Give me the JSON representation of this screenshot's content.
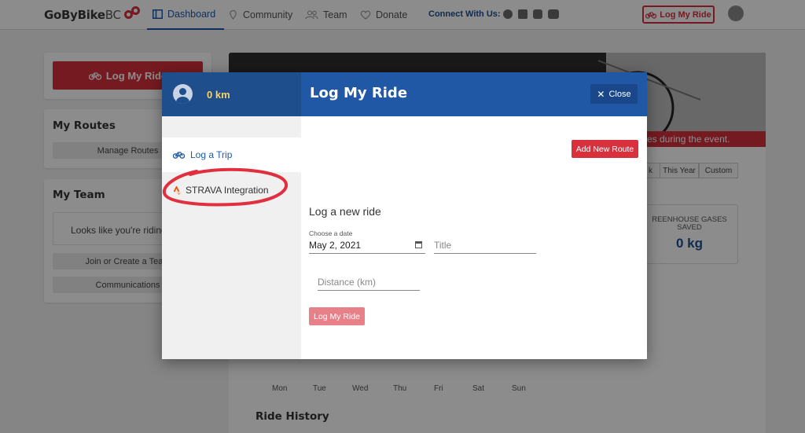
{
  "brand": {
    "name": "GoByBike",
    "suffix": "BC"
  },
  "nav": {
    "items": [
      {
        "label": "Dashboard",
        "icon": "dashboard-icon",
        "active": true
      },
      {
        "label": "Community",
        "icon": "map-pin-icon"
      },
      {
        "label": "Team",
        "icon": "team-icon"
      },
      {
        "label": "Donate",
        "icon": "heart-icon"
      }
    ],
    "connect_label": "Connect With Us:",
    "social": [
      "facebook-icon",
      "twitter-icon",
      "instagram-icon",
      "youtube-icon"
    ],
    "log_ride_label": "Log My Ride"
  },
  "sidebar": {
    "log_ride_label": "Log My Ride",
    "routes_title": "My Routes",
    "manage_routes_label": "Manage Routes",
    "team_title": "My Team",
    "team_message": "Looks like you're riding",
    "join_team_label": "Join or Create a Team",
    "communications_label": "Communications"
  },
  "main": {
    "banner_text": "es during the event.",
    "periods": [
      "k",
      "This Year",
      "Custom"
    ],
    "stat": {
      "label": "GREENHOUSE GASES SAVED",
      "label_line1": "REENHOUSE GASES",
      "label_line2": "SAVED",
      "value": "0 kg"
    },
    "days": [
      "Mon",
      "Tue",
      "Wed",
      "Thu",
      "Fri",
      "Sat",
      "Sun"
    ],
    "ride_history_title": "Ride History"
  },
  "modal": {
    "distance_total": "0 km",
    "title": "Log My Ride",
    "close_label": "Close",
    "tabs": [
      {
        "label": "Log a Trip",
        "icon": "bicycle-icon",
        "active": true
      },
      {
        "label": "STRAVA Integration",
        "icon": "strava-icon"
      }
    ],
    "add_route_label": "Add New Route",
    "form_heading": "Log a new ride",
    "date_label": "Choose a date",
    "date_value": "May 2, 2021",
    "title_placeholder": "Title",
    "distance_placeholder": "Distance (km)",
    "submit_label": "Log My Ride"
  },
  "colors": {
    "brand_red": "#d8303d",
    "brand_blue": "#2158a6",
    "annotation_red": "#e0303f",
    "km_yellow": "#f3d36b"
  }
}
